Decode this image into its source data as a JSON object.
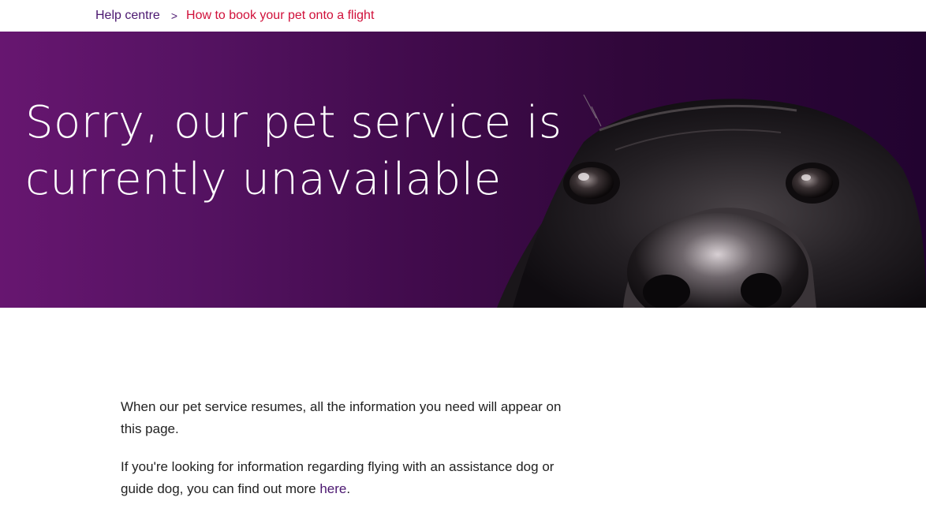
{
  "breadcrumb": {
    "home": "Help centre",
    "separator": ">",
    "current": "How to book your pet onto a flight"
  },
  "hero": {
    "title_line1": "Sorry, our pet service is",
    "title_line2": "currently unavailable",
    "image": "black dog looking up"
  },
  "content": {
    "paragraph1": "When our pet service resumes, all the information you need will appear on this page.",
    "paragraph2_text": "If you're looking for information regarding flying with an assistance dog or guide dog, you can find out more ",
    "paragraph2_link": "here",
    "paragraph2_end": "."
  },
  "colors": {
    "brand_purple": "#4b1770",
    "breadcrumb_current": "#d0103a",
    "hero_start": "#671670",
    "hero_end": "#220330"
  }
}
